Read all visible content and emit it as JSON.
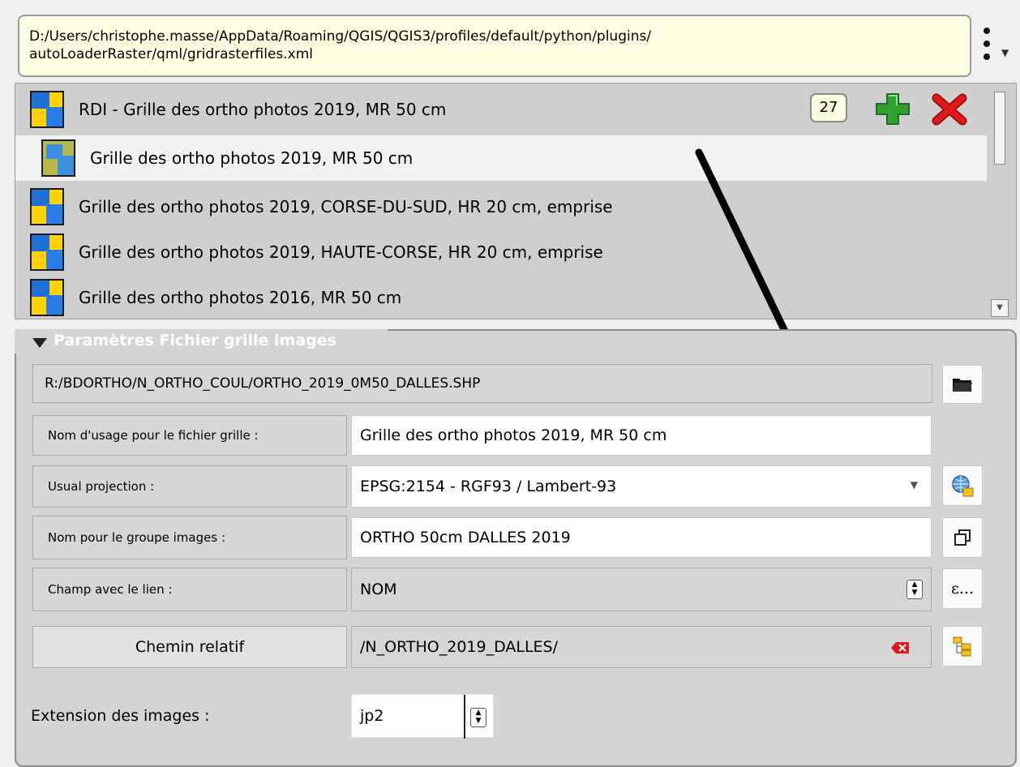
{
  "path_box": {
    "line1": "D:/Users/christophe.masse/AppData/Roaming/QGIS/QGIS3/profiles/default/python/plugins/",
    "line2": "autoLoaderRaster/qml/gridrasterfiles.xml"
  },
  "tree": {
    "count": "27",
    "items": [
      {
        "label": "RDI - Grille des ortho photos 2019, MR 50 cm"
      },
      {
        "label": "Grille des ortho photos 2019, MR 50 cm"
      },
      {
        "label": "Grille des ortho photos 2019, CORSE-DU-SUD, HR 20 cm, emprise"
      },
      {
        "label": "Grille des ortho photos 2019, HAUTE-CORSE, HR 20 cm, emprise"
      },
      {
        "label": "Grille des ortho photos 2016, MR 50 cm"
      }
    ]
  },
  "params": {
    "title": "Paramètres Fichier grille images",
    "shp_path": "R:/BDORTHO/N_ORTHO_COUL/ORTHO_2019_0M50_DALLES.SHP",
    "nom_usage_label": "Nom d'usage pour le fichier grille :",
    "nom_usage_value": "Grille des ortho photos 2019, MR 50 cm",
    "projection_label": "Usual projection :",
    "projection_value": "EPSG:2154 - RGF93 / Lambert-93",
    "groupe_label": "Nom pour le groupe images :",
    "groupe_value": "ORTHO 50cm DALLES 2019",
    "champ_label": "Champ avec le lien :",
    "champ_value": "NOM",
    "expr_button": "ε...",
    "chemin_button": "Chemin relatif",
    "chemin_value": "/N_ORTHO_2019_DALLES/",
    "extension_label": "Extension des images :",
    "extension_value": "jp2"
  },
  "colors": {
    "tooltip_bg": "#ffffe1",
    "panel_bg": "#d4d4d4",
    "add_green": "#2fa02f",
    "delete_red": "#e01818"
  }
}
